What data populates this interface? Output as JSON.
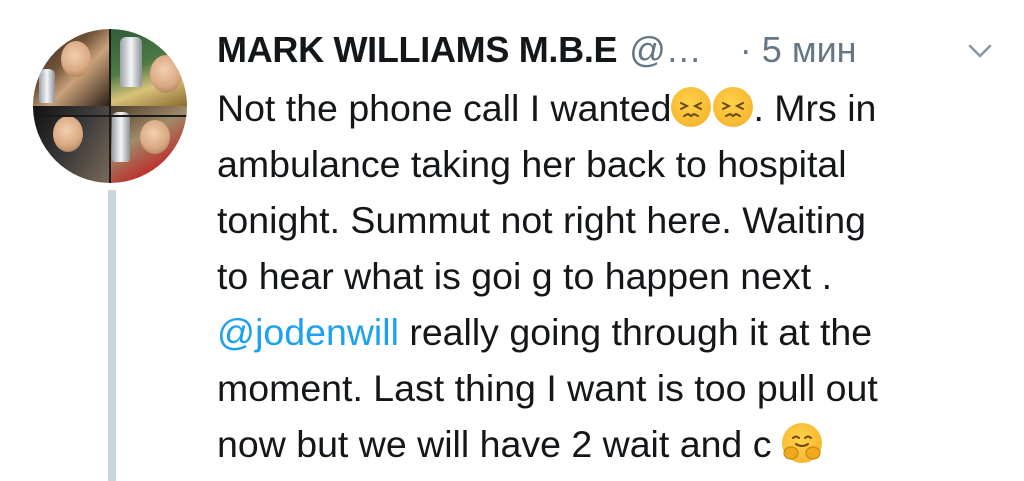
{
  "tweet": {
    "author_name": "MARK WILLIAMS M.B.E",
    "author_handle": "@…",
    "separator": "·",
    "timestamp": "5 мин",
    "body_lines": [
      {
        "before": "Not the phone call I wanted",
        "emojis": [
          "confounded-face-icon",
          "confounded-face-icon"
        ],
        "after": ".  Mrs in"
      },
      {
        "text": "ambulance taking her back to hospital"
      },
      {
        "text": "tonight.  Summut not right here.  Waiting"
      },
      {
        "text": "to hear what is goi g to happen next ."
      },
      {
        "mention": "@jodenwill",
        "after": " really going through it at the"
      },
      {
        "text": "moment. Last thing I want is too pull out"
      },
      {
        "before": "now but we will have 2 wait and c ",
        "emojis": [
          "hugging-face-icon"
        ]
      }
    ]
  },
  "colors": {
    "text": "#14171a",
    "secondary_text": "#657786",
    "link": "#1da1f2",
    "thread_line": "#ccd6dd"
  },
  "icons": {
    "menu": "chevron-down-icon"
  }
}
